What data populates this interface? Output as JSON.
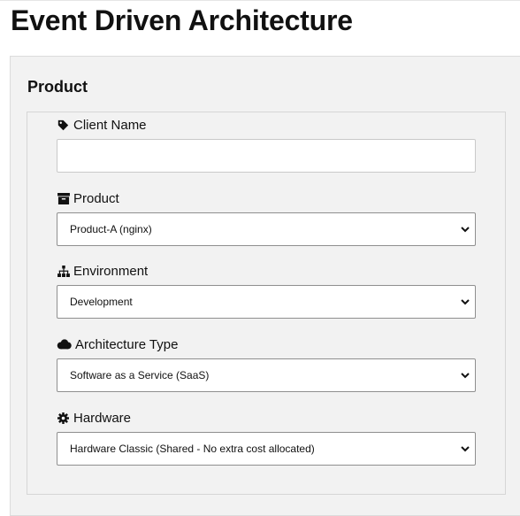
{
  "page": {
    "title": "Event Driven Architecture"
  },
  "panel": {
    "title": "Product"
  },
  "fields": {
    "client_name": {
      "label": "Client Name",
      "icon": "tag-icon",
      "value": "",
      "placeholder": ""
    },
    "product": {
      "label": "Product",
      "icon": "archive-box-icon",
      "selected": "Product-A (nginx)"
    },
    "environment": {
      "label": "Environment",
      "icon": "sitemap-icon",
      "selected": "Development"
    },
    "architecture_type": {
      "label": "Architecture Type",
      "icon": "cloud-icon",
      "selected": "Software as a Service (SaaS)"
    },
    "hardware": {
      "label": "Hardware",
      "icon": "gear-icon",
      "selected": "Hardware Classic (Shared - No extra cost allocated)"
    }
  }
}
